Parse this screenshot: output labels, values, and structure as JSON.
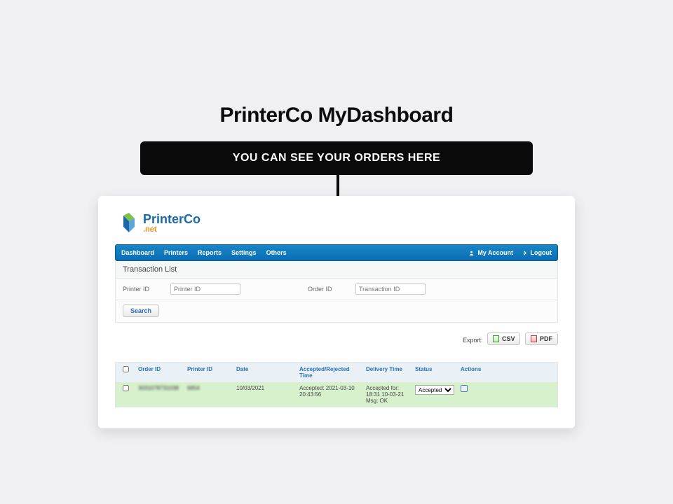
{
  "page": {
    "title": "PrinterCo MyDashboard"
  },
  "callout": {
    "text": "YOU CAN SEE YOUR ORDERS HERE"
  },
  "logo": {
    "brand": "PrinterCo",
    "suffix": ".net"
  },
  "nav": {
    "items": [
      {
        "label": "Dashboard"
      },
      {
        "label": "Printers"
      },
      {
        "label": "Reports"
      },
      {
        "label": "Settings"
      },
      {
        "label": "Others"
      }
    ],
    "account": "My Account",
    "logout": "Logout"
  },
  "section": {
    "title": "Transaction List"
  },
  "filters": {
    "printer_label": "Printer ID",
    "printer_placeholder": "Printer ID",
    "order_label": "Order ID",
    "order_placeholder": "Transaction ID",
    "search": "Search"
  },
  "export": {
    "label": "Export:",
    "csv": "CSV",
    "pdf": "PDF"
  },
  "table": {
    "headers": {
      "order_id": "Order ID",
      "printer_id": "Printer ID",
      "date": "Date",
      "acc_rej": "Accepted/Rejected Time",
      "delivery": "Delivery Time",
      "status": "Status",
      "actions": "Actions"
    },
    "rows": [
      {
        "order_id": "3031078731038",
        "printer_id": "6654",
        "date": "10/03/2021",
        "accepted_line1": "Accepted: 2021-03-10",
        "accepted_line2": "20:43:56",
        "delivery_line1": "Accepted for: 18:31 10-03-21",
        "delivery_line2": "Msg: OK",
        "status": "Accepted"
      }
    ]
  }
}
